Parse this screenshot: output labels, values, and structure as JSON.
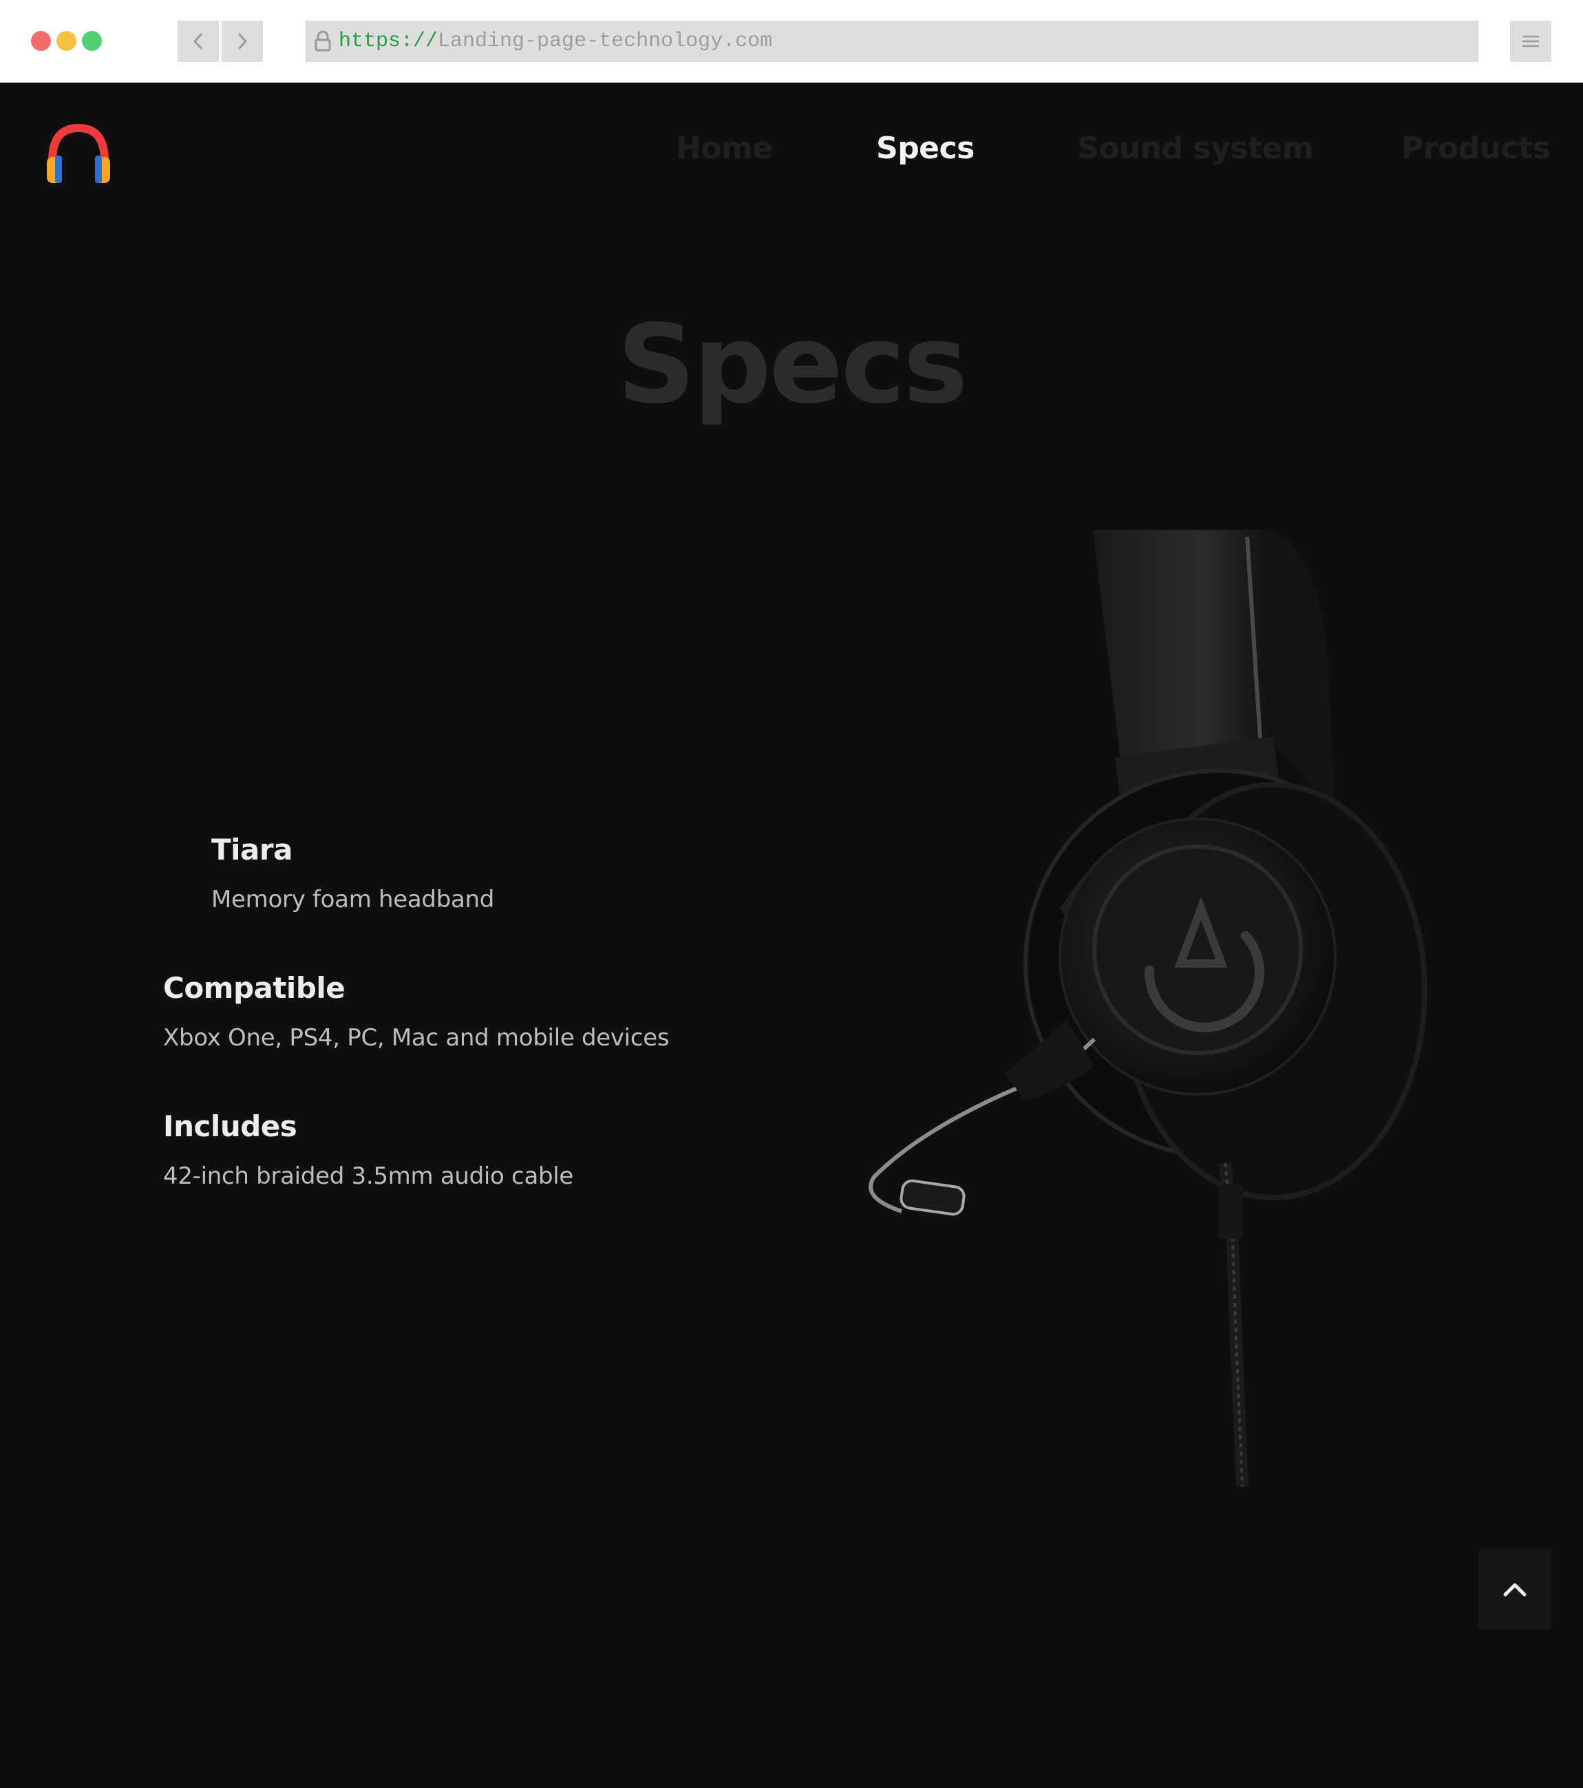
{
  "browser": {
    "url_scheme": "https://",
    "url_host": "Landing-page-technology.com"
  },
  "nav": {
    "items": [
      {
        "label": "Home",
        "active": false
      },
      {
        "label": "Specs",
        "active": true
      },
      {
        "label": "Sound system",
        "active": false
      },
      {
        "label": "Products",
        "active": false
      }
    ]
  },
  "hero": {
    "title": "Specs"
  },
  "specs": [
    {
      "title": "Tiara",
      "description": "Memory foam headband"
    },
    {
      "title": "Compatible",
      "description": "Xbox One, PS4, PC, Mac and mobile devices"
    },
    {
      "title": "Includes",
      "description": "42-inch braided 3.5mm audio cable"
    }
  ],
  "colors": {
    "background": "#0f0f10",
    "nav_inactive": "#1f1f21",
    "nav_active": "#f4f4f4",
    "title_muted": "#2b2b2d",
    "logo_band": "#ee3b3b",
    "logo_cups": "#f5a623"
  },
  "icons": {
    "logo": "headphones-logo",
    "back": "chevron-left-icon",
    "forward": "chevron-right-icon",
    "lock": "lock-icon",
    "menu": "menu-icon",
    "scroll_top": "chevron-up-icon"
  }
}
